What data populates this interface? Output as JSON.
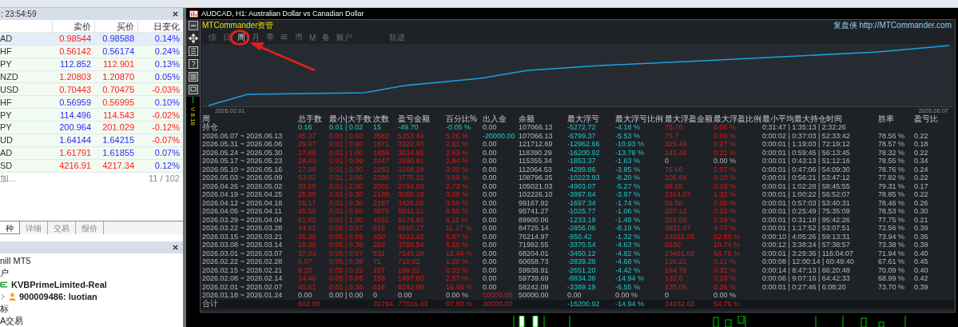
{
  "market_watch": {
    "time": ": 23:54:59",
    "columns": [
      "卖价",
      "买价",
      "日变化"
    ],
    "rows": [
      {
        "symbol": "AD",
        "selected": true,
        "bid": {
          "text": "0.98544",
          "kind": "down"
        },
        "ask": {
          "text": "0.98588",
          "kind": "up"
        },
        "change": {
          "text": "0.14%",
          "kind": "up"
        }
      },
      {
        "symbol": "HF",
        "selected": false,
        "bid": {
          "text": "0.56142",
          "kind": "down"
        },
        "ask": {
          "text": "0.56174",
          "kind": "up"
        },
        "change": {
          "text": "0.24%",
          "kind": "up"
        }
      },
      {
        "symbol": "PY",
        "selected": false,
        "bid": {
          "text": "112.852",
          "kind": "up"
        },
        "ask": {
          "text": "112.901",
          "kind": "down"
        },
        "change": {
          "text": "0.13%",
          "kind": "up"
        }
      },
      {
        "symbol": "NZD",
        "selected": false,
        "bid": {
          "text": "1.20803",
          "kind": "down"
        },
        "ask": {
          "text": "1.20870",
          "kind": "down"
        },
        "change": {
          "text": "0.05%",
          "kind": "up"
        }
      },
      {
        "symbol": "USD",
        "selected": false,
        "bid": {
          "text": "0.70443",
          "kind": "down"
        },
        "ask": {
          "text": "0.70475",
          "kind": "down"
        },
        "change": {
          "text": "-0.03%",
          "kind": "down"
        }
      },
      {
        "symbol": "HF",
        "selected": false,
        "bid": {
          "text": "0.56959",
          "kind": "up"
        },
        "ask": {
          "text": "0.56995",
          "kind": "down"
        },
        "change": {
          "text": "0.10%",
          "kind": "up"
        }
      },
      {
        "symbol": "PY",
        "selected": false,
        "bid": {
          "text": "114.496",
          "kind": "up"
        },
        "ask": {
          "text": "114.543",
          "kind": "down"
        },
        "change": {
          "text": "-0.02%",
          "kind": "down"
        }
      },
      {
        "symbol": "PY",
        "selected": false,
        "bid": {
          "text": "200.964",
          "kind": "up"
        },
        "ask": {
          "text": "201.029",
          "kind": "down"
        },
        "change": {
          "text": "-0.12%",
          "kind": "down"
        }
      },
      {
        "symbol": "UD",
        "selected": false,
        "bid": {
          "text": "1.64144",
          "kind": "up"
        },
        "ask": {
          "text": "1.64215",
          "kind": "up"
        },
        "change": {
          "text": "-0.07%",
          "kind": "down"
        }
      },
      {
        "symbol": "AD",
        "selected": false,
        "bid": {
          "text": "1.61791",
          "kind": "down"
        },
        "ask": {
          "text": "1.61855",
          "kind": "up"
        },
        "change": {
          "text": "0.07%",
          "kind": "up"
        }
      },
      {
        "symbol": "SD",
        "selected": false,
        "bid": {
          "text": "4216.91",
          "kind": "down"
        },
        "ask": {
          "text": "4217.34",
          "kind": "down"
        },
        "change": {
          "text": "0.12%",
          "kind": "up"
        }
      }
    ],
    "add_label": "加...",
    "count": "11 / 102"
  },
  "bottom_tabs": [
    {
      "label": "种",
      "selected": true
    },
    {
      "label": "详细",
      "selected": false
    },
    {
      "label": "交易",
      "selected": false
    },
    {
      "label": "报价",
      "selected": false
    }
  ],
  "navigator": {
    "items": [
      {
        "kind": "text",
        "label": "nill MT5"
      },
      {
        "kind": "text",
        "label": "户"
      },
      {
        "kind": "server",
        "label": "KVBPrimeLimited-Real"
      },
      {
        "kind": "account",
        "label": "900009486: luotian"
      },
      {
        "kind": "text",
        "label": "标"
      },
      {
        "kind": "text",
        "label": "A交易"
      }
    ]
  },
  "chart_window": {
    "title": "AUDCAD, H1:  Australian Dollar vs Canadian Dollar",
    "version": "V 8.18"
  },
  "panel": {
    "brand": "MTCommander资管",
    "site": "复盘侠  http://MTCommander.com",
    "tabs": [
      {
        "label": "综",
        "selected": false
      },
      {
        "label": "日",
        "selected": false
      },
      {
        "label": "周",
        "selected": true
      },
      {
        "label": "月",
        "selected": false
      },
      {
        "label": "季",
        "selected": false
      },
      {
        "label": "年",
        "selected": false
      },
      {
        "label": "币",
        "selected": false
      },
      {
        "label": "M",
        "selected": false
      },
      {
        "label": "备",
        "selected": false
      },
      {
        "label": "账户",
        "selected": false
      },
      {
        "label": "轨迹",
        "selected": false
      }
    ],
    "date_start": "2026.02.01",
    "date_end": "2026.06.07",
    "table": {
      "columns": [
        "周",
        "总手数",
        "最小|大手数",
        "次数",
        "盈亏金额",
        "百分比%",
        "出入金",
        "余额",
        "最大浮亏",
        "最大浮亏比例",
        "最大浮盈金额",
        "最大浮盈比例",
        "最小平均最大持仓时间",
        "胜率",
        "盈亏比"
      ],
      "rows": [
        {
          "kind": "open",
          "cells": [
            {
              "text": "持仓",
              "kind": "plain"
            },
            {
              "text": "0.16",
              "kind": "loss"
            },
            {
              "text": "0.01 | 0.02",
              "kind": "loss"
            },
            {
              "text": "15",
              "kind": "loss"
            },
            {
              "text": "-49.70",
              "kind": "loss"
            },
            {
              "text": "-0.05 %",
              "kind": "loss"
            },
            {
              "text": "0.00",
              "kind": "plain"
            },
            {
              "text": "107066.13",
              "kind": "plain"
            },
            {
              "text": "-5272.72",
              "kind": "loss"
            },
            {
              "text": "-4.18 %",
              "kind": "loss"
            },
            {
              "text": "75.70",
              "kind": "gain"
            },
            {
              "text": "0.06 %",
              "kind": "gain"
            },
            {
              "text": "0:31:47 | 1:35:13 | 2:32:26",
              "kind": "plain"
            },
            null,
            null
          ]
        },
        {
          "kind": "week",
          "cells": [
            {
              "text": "2026.06.07 ~ 2026.06.13",
              "kind": "plain"
            },
            {
              "text": "45.27",
              "kind": "gain"
            },
            {
              "text": "0.01 | 0.60",
              "kind": "gain"
            },
            {
              "text": "3582",
              "kind": "gain"
            },
            {
              "text": "5353.44",
              "kind": "gain"
            },
            {
              "text": "5.26 %",
              "kind": "gain"
            },
            {
              "text": "-20000.00",
              "kind": "loss"
            },
            {
              "text": "107066.13",
              "kind": "plain"
            },
            {
              "text": "-6799.37",
              "kind": "loss"
            },
            {
              "text": "-5.53 %",
              "kind": "loss"
            },
            {
              "text": "75.7",
              "kind": "gain"
            },
            {
              "text": "0.06 %",
              "kind": "gain"
            },
            {
              "text": "0:00:02 | 0:37:03 | 52:33:42",
              "kind": "plain"
            },
            {
              "text": "78.56 %",
              "kind": "plain"
            },
            {
              "text": "0.22",
              "kind": "plain"
            }
          ]
        },
        {
          "kind": "week",
          "cells": [
            {
              "text": "2026.05.31 ~ 2026.06.06",
              "kind": "plain"
            },
            {
              "text": "29.97",
              "kind": "gain"
            },
            {
              "text": "0.01 | 0.90",
              "kind": "gain"
            },
            {
              "text": "1871",
              "kind": "gain"
            },
            {
              "text": "3322.40",
              "kind": "gain"
            },
            {
              "text": "2.81 %",
              "kind": "gain"
            },
            {
              "text": "0.00",
              "kind": "plain"
            },
            {
              "text": "121712.69",
              "kind": "plain"
            },
            {
              "text": "-12962.66",
              "kind": "loss"
            },
            {
              "text": "-10.93 %",
              "kind": "loss"
            },
            {
              "text": "325.49",
              "kind": "gain"
            },
            {
              "text": "0.27 %",
              "kind": "gain"
            },
            {
              "text": "0:00:01 | 1:19:03 | 72:19:12",
              "kind": "plain"
            },
            {
              "text": "78.57 %",
              "kind": "plain"
            },
            {
              "text": "0.18",
              "kind": "plain"
            }
          ]
        },
        {
          "kind": "week",
          "cells": [
            {
              "text": "2026.05.24 ~ 2026.05.30",
              "kind": "plain"
            },
            {
              "text": "27.88",
              "kind": "gain"
            },
            {
              "text": "0.01 | 1.00",
              "kind": "gain"
            },
            {
              "text": "1859",
              "kind": "gain"
            },
            {
              "text": "3034.95",
              "kind": "gain"
            },
            {
              "text": "2.63 %",
              "kind": "gain"
            },
            {
              "text": "0.00",
              "kind": "plain"
            },
            {
              "text": "118390.29",
              "kind": "plain"
            },
            {
              "text": "-16200.92",
              "kind": "loss"
            },
            {
              "text": "-13.78 %",
              "kind": "loss"
            },
            {
              "text": "243.46",
              "kind": "gain"
            },
            {
              "text": "0.21 %",
              "kind": "gain"
            },
            {
              "text": "0:00:01 | 0:59:45 | 56:13:45",
              "kind": "plain"
            },
            {
              "text": "78.32 %",
              "kind": "plain"
            },
            {
              "text": "0.22",
              "kind": "plain"
            }
          ]
        },
        {
          "kind": "week",
          "cells": [
            {
              "text": "2026.05.17 ~ 2026.05.23",
              "kind": "plain"
            },
            {
              "text": "28.43",
              "kind": "gain"
            },
            {
              "text": "0.01 | 0.09",
              "kind": "gain"
            },
            {
              "text": "2447",
              "kind": "gain"
            },
            {
              "text": "3290.81",
              "kind": "gain"
            },
            {
              "text": "2.94 %",
              "kind": "gain"
            },
            {
              "text": "0.00",
              "kind": "plain"
            },
            {
              "text": "115355.34",
              "kind": "plain"
            },
            {
              "text": "-1853.37",
              "kind": "loss"
            },
            {
              "text": "-1.63 %",
              "kind": "loss"
            },
            {
              "text": "0",
              "kind": "plain"
            },
            {
              "text": "0.00 %",
              "kind": "plain"
            },
            {
              "text": "0:00:01 | 0:43:13 | 51:12:16",
              "kind": "plain"
            },
            {
              "text": "78.55 %",
              "kind": "plain"
            },
            {
              "text": "0.34",
              "kind": "plain"
            }
          ]
        },
        {
          "kind": "week",
          "cells": [
            {
              "text": "2026.05.10 ~ 2026.05.16",
              "kind": "plain"
            },
            {
              "text": "27.96",
              "kind": "gain"
            },
            {
              "text": "0.01 | 0.30",
              "kind": "gain"
            },
            {
              "text": "2283",
              "kind": "gain"
            },
            {
              "text": "3268.28",
              "kind": "gain"
            },
            {
              "text": "3.00 %",
              "kind": "gain"
            },
            {
              "text": "0.00",
              "kind": "plain"
            },
            {
              "text": "112064.53",
              "kind": "plain"
            },
            {
              "text": "-4289.86",
              "kind": "loss"
            },
            {
              "text": "-3.85 %",
              "kind": "loss"
            },
            {
              "text": "76.66",
              "kind": "gain"
            },
            {
              "text": "0.07 %",
              "kind": "gain"
            },
            {
              "text": "0:00:01 | 0:47:06 | 54:09:30",
              "kind": "plain"
            },
            {
              "text": "78.76 %",
              "kind": "plain"
            },
            {
              "text": "0.24",
              "kind": "plain"
            }
          ]
        },
        {
          "kind": "week",
          "cells": [
            {
              "text": "2026.05.03 ~ 2026.05.09",
              "kind": "plain"
            },
            {
              "text": "53.92",
              "kind": "gain"
            },
            {
              "text": "0.01 | 2.00",
              "kind": "gain"
            },
            {
              "text": "2399",
              "kind": "gain"
            },
            {
              "text": "3775.22",
              "kind": "gain"
            },
            {
              "text": "3.59 %",
              "kind": "gain"
            },
            {
              "text": "0.00",
              "kind": "plain"
            },
            {
              "text": "108796.25",
              "kind": "plain"
            },
            {
              "text": "-10223.93",
              "kind": "loss"
            },
            {
              "text": "-8.20 %",
              "kind": "loss"
            },
            {
              "text": "105.84",
              "kind": "gain"
            },
            {
              "text": "0.10 %",
              "kind": "gain"
            },
            {
              "text": "0:00:01 | 0:56:21 | 53:47:12",
              "kind": "plain"
            },
            {
              "text": "77.82 %",
              "kind": "plain"
            },
            {
              "text": "0.22",
              "kind": "plain"
            }
          ]
        },
        {
          "kind": "week",
          "cells": [
            {
              "text": "2026.04.26 ~ 2026.05.02",
              "kind": "plain"
            },
            {
              "text": "33.66",
              "kind": "gain"
            },
            {
              "text": "0.01 | 2.00",
              "kind": "gain"
            },
            {
              "text": "2001",
              "kind": "gain"
            },
            {
              "text": "2794.93",
              "kind": "gain"
            },
            {
              "text": "2.73 %",
              "kind": "gain"
            },
            {
              "text": "0.00",
              "kind": "plain"
            },
            {
              "text": "105021.03",
              "kind": "plain"
            },
            {
              "text": "-4903.07",
              "kind": "loss"
            },
            {
              "text": "-5.27 %",
              "kind": "loss"
            },
            {
              "text": "99.55",
              "kind": "gain"
            },
            {
              "text": "0.10 %",
              "kind": "gain"
            },
            {
              "text": "0:00:01 | 1:02:28 | 58:45:55",
              "kind": "plain"
            },
            {
              "text": "79.31 %",
              "kind": "plain"
            },
            {
              "text": "0.17",
              "kind": "plain"
            }
          ]
        },
        {
          "kind": "week",
          "cells": [
            {
              "text": "2026.04.19 ~ 2026.04.25",
              "kind": "plain"
            },
            {
              "text": "25.88",
              "kind": "gain"
            },
            {
              "text": "0.01 | 0.30",
              "kind": "gain"
            },
            {
              "text": "2189",
              "kind": "gain"
            },
            {
              "text": "3058.18",
              "kind": "gain"
            },
            {
              "text": "3.08 %",
              "kind": "gain"
            },
            {
              "text": "0.00",
              "kind": "plain"
            },
            {
              "text": "102226.10",
              "kind": "plain"
            },
            {
              "text": "-3997.64",
              "kind": "loss"
            },
            {
              "text": "-3.97 %",
              "kind": "loss"
            },
            {
              "text": "1314.07",
              "kind": "gain"
            },
            {
              "text": "1.32 %",
              "kind": "gain"
            },
            {
              "text": "0:00:01 | 1:00:22 | 56:52:07",
              "kind": "plain"
            },
            {
              "text": "78.85 %",
              "kind": "plain"
            },
            {
              "text": "0.22",
              "kind": "plain"
            }
          ]
        },
        {
          "kind": "week",
          "cells": [
            {
              "text": "2026.04.12 ~ 2026.04.18",
              "kind": "plain"
            },
            {
              "text": "26.17",
              "kind": "gain"
            },
            {
              "text": "0.01 | 0.30",
              "kind": "gain"
            },
            {
              "text": "2187",
              "kind": "gain"
            },
            {
              "text": "3426.65",
              "kind": "gain"
            },
            {
              "text": "3.58 %",
              "kind": "gain"
            },
            {
              "text": "0.00",
              "kind": "plain"
            },
            {
              "text": "99167.92",
              "kind": "plain"
            },
            {
              "text": "-1697.34",
              "kind": "loss"
            },
            {
              "text": "-1.74 %",
              "kind": "loss"
            },
            {
              "text": "56.56",
              "kind": "gain"
            },
            {
              "text": "0.06 %",
              "kind": "gain"
            },
            {
              "text": "0:00:01 | 0:57:03 | 53:40:31",
              "kind": "plain"
            },
            {
              "text": "78.46 %",
              "kind": "plain"
            },
            {
              "text": "0.26",
              "kind": "plain"
            }
          ]
        },
        {
          "kind": "week",
          "cells": [
            {
              "text": "2026.04.05 ~ 2026.04.11",
              "kind": "plain"
            },
            {
              "text": "45.59",
              "kind": "gain"
            },
            {
              "text": "0.01 | 0.60",
              "kind": "gain"
            },
            {
              "text": "3978",
              "kind": "gain"
            },
            {
              "text": "5841.21",
              "kind": "gain"
            },
            {
              "text": "6.50 %",
              "kind": "gain"
            },
            {
              "text": "0.00",
              "kind": "plain"
            },
            {
              "text": "95741.27",
              "kind": "plain"
            },
            {
              "text": "-1025.77",
              "kind": "loss"
            },
            {
              "text": "-1.06 %",
              "kind": "loss"
            },
            {
              "text": "207.12",
              "kind": "gain"
            },
            {
              "text": "0.22 %",
              "kind": "gain"
            },
            {
              "text": "0:00:01 | 0:25:49 | 75:35:09",
              "kind": "plain"
            },
            {
              "text": "78.53 %",
              "kind": "plain"
            },
            {
              "text": "0.30",
              "kind": "plain"
            }
          ]
        },
        {
          "kind": "week",
          "cells": [
            {
              "text": "2026.03.29 ~ 2026.04.04",
              "kind": "plain"
            },
            {
              "text": "61.85",
              "kind": "gain"
            },
            {
              "text": "0.01 | 1.00",
              "kind": "gain"
            },
            {
              "text": "4261",
              "kind": "gain"
            },
            {
              "text": "5174.92",
              "kind": "gain"
            },
            {
              "text": "6.11 %",
              "kind": "gain"
            },
            {
              "text": "0.00",
              "kind": "plain"
            },
            {
              "text": "89900.06",
              "kind": "plain"
            },
            {
              "text": "-1233.19",
              "kind": "loss"
            },
            {
              "text": "-1.48 %",
              "kind": "loss"
            },
            {
              "text": "251.59",
              "kind": "gain"
            },
            {
              "text": "0.29 %",
              "kind": "gain"
            },
            {
              "text": "0:00:01 | 0:31:18 | 95:42:26",
              "kind": "plain"
            },
            {
              "text": "77.75 %",
              "kind": "plain"
            },
            {
              "text": "0.21",
              "kind": "plain"
            }
          ]
        },
        {
          "kind": "week",
          "cells": [
            {
              "text": "2026.03.22 ~ 2026.03.28",
              "kind": "plain"
            },
            {
              "text": "44.61",
              "kind": "gain"
            },
            {
              "text": "0.05 | 0.57",
              "kind": "gain"
            },
            {
              "text": "616",
              "kind": "gain"
            },
            {
              "text": "8510.17",
              "kind": "gain"
            },
            {
              "text": "11.17 %",
              "kind": "gain"
            },
            {
              "text": "0.00",
              "kind": "plain"
            },
            {
              "text": "84725.14",
              "kind": "plain"
            },
            {
              "text": "-2856.06",
              "kind": "loss"
            },
            {
              "text": "-8.19 %",
              "kind": "loss"
            },
            {
              "text": "3821.67",
              "kind": "gain"
            },
            {
              "text": "4.73 %",
              "kind": "gain"
            },
            {
              "text": "0:00:01 | 1:17:52 | 53:07:51",
              "kind": "plain"
            },
            {
              "text": "72.56 %",
              "kind": "plain"
            },
            {
              "text": "0.39",
              "kind": "plain"
            }
          ]
        },
        {
          "kind": "week",
          "cells": [
            {
              "text": "2026.03.15 ~ 2026.03.21",
              "kind": "plain"
            },
            {
              "text": "26.30",
              "kind": "gain"
            },
            {
              "text": "0.05 | 0.85",
              "kind": "gain"
            },
            {
              "text": "330",
              "kind": "gain"
            },
            {
              "text": "4222.42",
              "kind": "gain"
            },
            {
              "text": "5.87 %",
              "kind": "gain"
            },
            {
              "text": "0.00",
              "kind": "plain"
            },
            {
              "text": "76214.97",
              "kind": "plain"
            },
            {
              "text": "-950.42",
              "kind": "loss"
            },
            {
              "text": "-1.32 %",
              "kind": "loss"
            },
            {
              "text": "24932.65",
              "kind": "gain"
            },
            {
              "text": "52.50 %",
              "kind": "gain"
            },
            {
              "text": "0:00:10 | 4:05:26 | 59:13:31",
              "kind": "plain"
            },
            {
              "text": "73.94 %",
              "kind": "plain"
            },
            {
              "text": "0.36",
              "kind": "plain"
            }
          ]
        },
        {
          "kind": "week",
          "cells": [
            {
              "text": "2026.03.08 ~ 2026.03.14",
              "kind": "plain"
            },
            {
              "text": "19.95",
              "kind": "gain"
            },
            {
              "text": "0.05 | 0.38",
              "kind": "gain"
            },
            {
              "text": "293",
              "kind": "gain"
            },
            {
              "text": "3788.54",
              "kind": "gain"
            },
            {
              "text": "5.55 %",
              "kind": "gain"
            },
            {
              "text": "0.00",
              "kind": "plain"
            },
            {
              "text": "71992.55",
              "kind": "plain"
            },
            {
              "text": "-3370.54",
              "kind": "loss"
            },
            {
              "text": "-4.63 %",
              "kind": "loss"
            },
            {
              "text": "6630",
              "kind": "gain"
            },
            {
              "text": "10.74 %",
              "kind": "gain"
            },
            {
              "text": "0:00:12 | 3:38:24 | 57:38:57",
              "kind": "plain"
            },
            {
              "text": "73.38 %",
              "kind": "plain"
            },
            {
              "text": "0.39",
              "kind": "plain"
            }
          ]
        },
        {
          "kind": "week",
          "cells": [
            {
              "text": "2026.03.01 ~ 2026.03.07",
              "kind": "plain"
            },
            {
              "text": "37.94",
              "kind": "gain"
            },
            {
              "text": "0.05 | 0.57",
              "kind": "gain"
            },
            {
              "text": "531",
              "kind": "gain"
            },
            {
              "text": "7545.28",
              "kind": "gain"
            },
            {
              "text": "12.44 %",
              "kind": "gain"
            },
            {
              "text": "0.00",
              "kind": "plain"
            },
            {
              "text": "68204.01",
              "kind": "plain"
            },
            {
              "text": "-3450.12",
              "kind": "loss"
            },
            {
              "text": "-4.82 %",
              "kind": "loss"
            },
            {
              "text": "23461.65",
              "kind": "gain"
            },
            {
              "text": "54.76 %",
              "kind": "gain"
            },
            {
              "text": "0:00:01 | 3:29:36 | 116:04:07",
              "kind": "plain"
            },
            {
              "text": "71.94 %",
              "kind": "plain"
            },
            {
              "text": "0.40",
              "kind": "plain"
            }
          ]
        },
        {
          "kind": "week",
          "cells": [
            {
              "text": "2026.02.22 ~ 2026.02.28",
              "kind": "plain"
            },
            {
              "text": "6.07",
              "kind": "gain"
            },
            {
              "text": "0.05 | 0.38",
              "kind": "gain"
            },
            {
              "text": "71",
              "kind": "gain"
            },
            {
              "text": "719.82",
              "kind": "gain"
            },
            {
              "text": "1.20 %",
              "kind": "gain"
            },
            {
              "text": "0.00",
              "kind": "plain"
            },
            {
              "text": "60658.73",
              "kind": "plain"
            },
            {
              "text": "-2839.38",
              "kind": "loss"
            },
            {
              "text": "-4.68 %",
              "kind": "loss"
            },
            {
              "text": "126.21",
              "kind": "gain"
            },
            {
              "text": "0.21 %",
              "kind": "gain"
            },
            {
              "text": "0:00:08 | 12:00:14 | 60:49:40",
              "kind": "plain"
            },
            {
              "text": "67.61 %",
              "kind": "plain"
            },
            {
              "text": "0.45",
              "kind": "plain"
            }
          ]
        },
        {
          "kind": "week",
          "cells": [
            {
              "text": "2026.02.15 ~ 2026.02.21",
              "kind": "plain"
            },
            {
              "text": "8.20",
              "kind": "gain"
            },
            {
              "text": "0.05 | 0.25",
              "kind": "gain"
            },
            {
              "text": "107",
              "kind": "gain"
            },
            {
              "text": "199.22",
              "kind": "gain"
            },
            {
              "text": "0.33 %",
              "kind": "gain"
            },
            {
              "text": "0.00",
              "kind": "plain"
            },
            {
              "text": "59938.91",
              "kind": "plain"
            },
            {
              "text": "-2651.20",
              "kind": "loss"
            },
            {
              "text": "-4.42 %",
              "kind": "loss"
            },
            {
              "text": "184.76",
              "kind": "gain"
            },
            {
              "text": "0.31 %",
              "kind": "gain"
            },
            {
              "text": "0:00:14 | 8:47:13 | 66:20:48",
              "kind": "plain"
            },
            {
              "text": "70.09 %",
              "kind": "plain"
            },
            {
              "text": "0.40",
              "kind": "plain"
            }
          ]
        },
        {
          "kind": "week",
          "cells": [
            {
              "text": "2026.02.08 ~ 2026.02.14",
              "kind": "plain"
            },
            {
              "text": "14.46",
              "kind": "gain"
            },
            {
              "text": "0.05 | 0.85",
              "kind": "gain"
            },
            {
              "text": "158",
              "kind": "gain"
            },
            {
              "text": "1497.60",
              "kind": "gain"
            },
            {
              "text": "2.57 %",
              "kind": "gain"
            },
            {
              "text": "0.00",
              "kind": "plain"
            },
            {
              "text": "59739.69",
              "kind": "plain"
            },
            {
              "text": "-8834.38",
              "kind": "loss"
            },
            {
              "text": "-14.94 %",
              "kind": "loss"
            },
            {
              "text": "132.6",
              "kind": "gain"
            },
            {
              "text": "0.23 %",
              "kind": "gain"
            },
            {
              "text": "0:00:06 | 9:07:16 | 64:42:33",
              "kind": "plain"
            },
            {
              "text": "68.99 %",
              "kind": "plain"
            },
            {
              "text": "0.42",
              "kind": "plain"
            }
          ]
        },
        {
          "kind": "week",
          "cells": [
            {
              "text": "2026.02.01 ~ 2026.02.07",
              "kind": "plain"
            },
            {
              "text": "40.61",
              "kind": "gain"
            },
            {
              "text": "0.01 | 0.38",
              "kind": "gain"
            },
            {
              "text": "616",
              "kind": "gain"
            },
            {
              "text": "8242.09",
              "kind": "gain"
            },
            {
              "text": "16.48 %",
              "kind": "gain"
            },
            {
              "text": "0.00",
              "kind": "plain"
            },
            {
              "text": "58242.09",
              "kind": "plain"
            },
            {
              "text": "-3389.19",
              "kind": "loss"
            },
            {
              "text": "-6.55 %",
              "kind": "loss"
            },
            {
              "text": "135.06",
              "kind": "gain"
            },
            {
              "text": "0.26 %",
              "kind": "gain"
            },
            {
              "text": "0:00:01 | 0:27:46 | 6:08:20",
              "kind": "plain"
            },
            {
              "text": "73.70 %",
              "kind": "plain"
            },
            {
              "text": "0.39",
              "kind": "plain"
            }
          ]
        },
        {
          "kind": "week",
          "cells": [
            {
              "text": "2026.01.18 ~ 2026.01.24",
              "kind": "plain"
            },
            {
              "text": "0.00",
              "kind": "plain"
            },
            {
              "text": "0.00 | 0.00",
              "kind": "plain"
            },
            {
              "text": "0",
              "kind": "plain"
            },
            {
              "text": "0.00",
              "kind": "plain"
            },
            {
              "text": "0.00 %",
              "kind": "plain"
            },
            {
              "text": "50000.00",
              "kind": "gain"
            },
            {
              "text": "50000.00",
              "kind": "plain"
            },
            {
              "text": "0.00",
              "kind": "plain"
            },
            {
              "text": "0.00 %",
              "kind": "plain"
            },
            {
              "text": "0",
              "kind": "plain"
            },
            {
              "text": "0.00 %",
              "kind": "plain"
            },
            null,
            null,
            null
          ]
        },
        {
          "kind": "total",
          "cells": [
            {
              "text": "合计",
              "kind": "plain"
            },
            {
              "text": "602.88",
              "kind": "gain"
            },
            null,
            {
              "text": "31794",
              "kind": "gain"
            },
            {
              "text": "77016.43",
              "kind": "gain"
            },
            {
              "text": "97.80 %",
              "kind": "gain"
            },
            {
              "text": "30000.00",
              "kind": "gain"
            },
            null,
            {
              "text": "-16200.92",
              "kind": "loss"
            },
            {
              "text": "-14.94 %",
              "kind": "loss"
            },
            {
              "text": "24932.65",
              "kind": "gain"
            },
            {
              "text": "54.76 %",
              "kind": "gain"
            },
            null,
            null,
            null
          ]
        }
      ]
    }
  }
}
